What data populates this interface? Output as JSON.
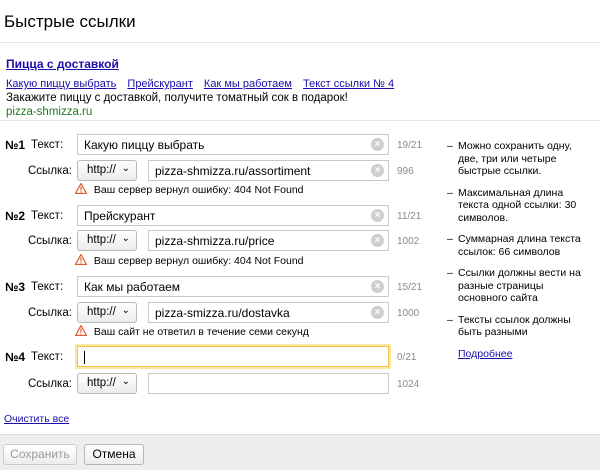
{
  "header": {
    "title": "Быстрые ссылки"
  },
  "preview": {
    "title": "Пицца с доставкой",
    "links": [
      "Какую пиццу выбрать",
      "Прейскурант",
      "Как мы работаем",
      "Текст ссылки № 4"
    ],
    "description": "Закажите пиццу с доставкой, получите томатный сок в подарок!",
    "url": "pizza-shmizza.ru"
  },
  "form": {
    "text_label": "Текст:",
    "link_label": "Ссылка:",
    "protocol": "http://",
    "links": [
      {
        "num": "№1",
        "text": "Какую пиццу выбрать",
        "text_count": "19/21",
        "url": "pizza-shmizza.ru/assortiment",
        "url_count": "996",
        "error": "Ваш сервер вернул ошибку: 404 Not Found"
      },
      {
        "num": "№2",
        "text": "Прейскурант",
        "text_count": "11/21",
        "url": "pizza-shmizza.ru/price",
        "url_count": "1002",
        "error": "Ваш сервер вернул ошибку: 404 Not Found"
      },
      {
        "num": "№3",
        "text": "Как мы работаем",
        "text_count": "15/21",
        "url": "pizza-smizza.ru/dostavka",
        "url_count": "1000",
        "error": "Ваш сайт не ответил в течение семи секунд"
      },
      {
        "num": "№4",
        "text": "",
        "text_count": "0/21",
        "url": "",
        "url_count": "1024",
        "error": ""
      }
    ]
  },
  "sidebar": {
    "tips": [
      "Можно сохранить одну, две, три или четыре быстрые ссылки.",
      "Максимальная длина текста одной ссылки: 30 символов.",
      "Суммарная длина текста ссылок: 66 символов",
      "Ссылки должны вести на разные страницы основного сайта",
      "Тексты ссылок должны быть разными"
    ],
    "more_link": "Подробнее"
  },
  "actions": {
    "clear_all": "Очистить все",
    "save": "Сохранить",
    "cancel": "Отмена"
  },
  "colors": {
    "link": "#1a0dab",
    "url_green": "#1e7b1e",
    "warning": "#e05a2b",
    "focus": "#f0c24c"
  }
}
